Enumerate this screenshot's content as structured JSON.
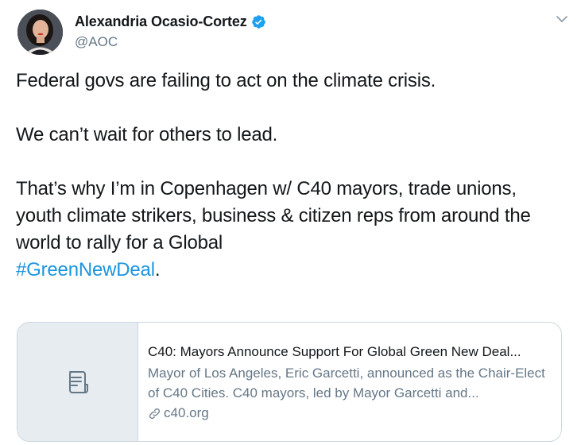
{
  "tweet": {
    "author": {
      "display_name": "Alexandria Ocasio-Cortez",
      "handle": "@AOC",
      "verified": true,
      "avatar_icon": "profile-photo"
    },
    "menu_icon": "chevron-down-icon",
    "paragraphs": [
      "Federal govs are failing to act on the climate crisis.",
      "We can’t wait for others to lead.",
      "That’s why I’m in Copenhagen w/ C40 mayors, trade unions, youth climate strikers, business & citizen reps from around the world to rally for a Global"
    ],
    "hashtag": "#GreenNewDeal",
    "hashtag_suffix": ".",
    "card": {
      "thumbnail_icon": "document-icon",
      "title": "C40: Mayors Announce Support For Global Green New Deal...",
      "description": "Mayor of Los Angeles, Eric Garcetti, announced as the Chair-Elect of C40 Cities.  C40 mayors, led by Mayor Garcetti and...",
      "domain": "c40.org",
      "domain_icon": "link-icon"
    }
  },
  "colors": {
    "text": "#14171a",
    "secondary": "#657786",
    "link": "#1b95e0",
    "verified_badge": "#1da1f2",
    "border": "#ccd6dd",
    "card_thumb_bg": "#e6ecf0"
  }
}
